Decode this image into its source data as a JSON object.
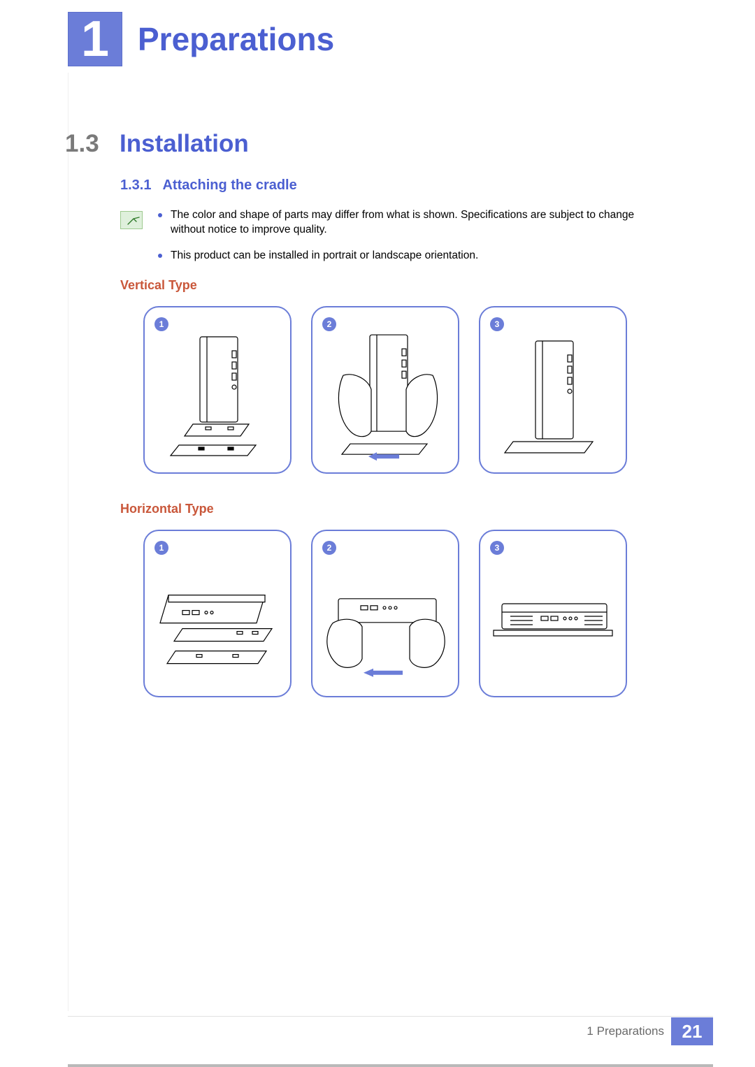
{
  "chapter": {
    "number": "1",
    "title": "Preparations"
  },
  "section": {
    "number": "1.3",
    "title": "Installation"
  },
  "subsection": {
    "number": "1.3.1",
    "title": "Attaching the cradle"
  },
  "notes": {
    "items": [
      "The color and shape of parts may differ from what is shown. Specifications are subject to change without notice to improve quality.",
      "This product can be installed in portrait or landscape orientation."
    ]
  },
  "types": {
    "vertical_label": "Vertical Type",
    "horizontal_label": "Horizontal Type"
  },
  "steps": {
    "vertical": [
      "1",
      "2",
      "3"
    ],
    "horizontal": [
      "1",
      "2",
      "3"
    ]
  },
  "footer": {
    "chapter_ref": "1 Preparations",
    "page": "21"
  }
}
